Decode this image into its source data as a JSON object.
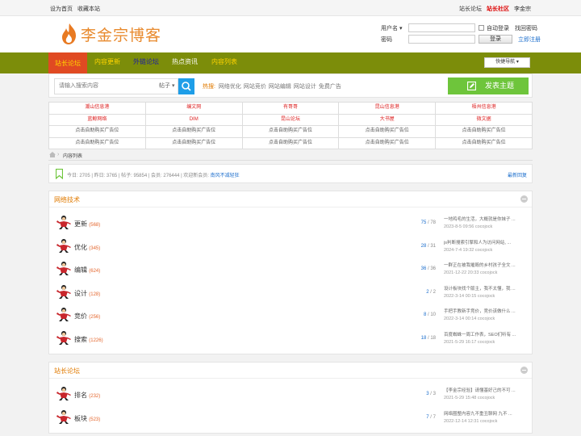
{
  "topbar": {
    "left": [
      "设为首页",
      "收藏本站"
    ],
    "right": [
      "站长论坛",
      "站长社区",
      "李金宗"
    ]
  },
  "logo": {
    "text": "李金宗博客"
  },
  "login": {
    "username_label": "用户名",
    "password_label": "密码",
    "auto_login": "自动登录",
    "forgot": "找回密码",
    "login_btn": "登录",
    "register": "立即注册"
  },
  "nav": {
    "items": [
      "站长论坛",
      "内容更新",
      "外链论坛",
      "热点资讯",
      "内容列表"
    ],
    "colors": [
      "#ffd400",
      "#ffd400",
      "#1a1aa6",
      "#ffffff",
      "#ffd400"
    ],
    "quick": "快捷导航"
  },
  "search": {
    "placeholder": "请输入搜索内容",
    "type": "帖子",
    "hot_label": "热搜:",
    "hot": [
      "网络优化",
      "网站竞价",
      "网站编辑",
      "网站设计",
      "免费广告"
    ],
    "post_btn": "发表主题"
  },
  "ads": {
    "rows": [
      [
        {
          "t": "潮山信息港",
          "c": "red"
        },
        {
          "t": "编文网",
          "c": "red"
        },
        {
          "t": "有哥哥",
          "c": "red"
        },
        {
          "t": "昆山信息港",
          "c": "red"
        },
        {
          "t": "梧州信息港",
          "c": "red"
        }
      ],
      [
        {
          "t": "蓝鲸网络",
          "c": "red"
        },
        {
          "t": "DIM",
          "c": "red"
        },
        {
          "t": "昆山论坛",
          "c": "red"
        },
        {
          "t": "大书屋",
          "c": "red"
        },
        {
          "t": "微文据",
          "c": "red"
        }
      ],
      [
        {
          "t": "点击自助购买广告位",
          "c": "gray"
        },
        {
          "t": "点击自助购买广告位",
          "c": "gray"
        },
        {
          "t": "点击自助购买广告位",
          "c": "gray"
        },
        {
          "t": "点击自助购买广告位",
          "c": "gray"
        },
        {
          "t": "点击自助购买广告位",
          "c": "gray"
        }
      ],
      [
        {
          "t": "点击自助购买广告位",
          "c": "gray"
        },
        {
          "t": "点击自助购买广告位",
          "c": "gray"
        },
        {
          "t": "点击自助购买广告位",
          "c": "gray"
        },
        {
          "t": "点击自助购买广告位",
          "c": "gray"
        },
        {
          "t": "点击自助购买广告位",
          "c": "gray"
        }
      ]
    ]
  },
  "breadcrumb": {
    "current": "内容列表"
  },
  "stats": {
    "text": "今日: 2705 | 昨日: 3765 | 帖子: 95854 | 会员: 276444 | 欢迎新会员:",
    "new_member": "南风不减轻狂",
    "latest": "最新回复"
  },
  "sections": [
    {
      "title": "网络技术",
      "forums": [
        {
          "name": "更新",
          "count": "(568)",
          "threads": "75",
          "posts": "78",
          "last_title": "一地鸡毛的生活，大概就是你妹子 ...",
          "last_date": "2023-8-5 09:56 cocojock"
        },
        {
          "name": "优化",
          "count": "(345)",
          "threads": "28",
          "posts": "31",
          "last_title": "js判断搜索引擎和人为访问网站, ...",
          "last_date": "2024-7-4 19:32 cocojock"
        },
        {
          "name": "编辑",
          "count": "(624)",
          "threads": "36",
          "posts": "36",
          "last_title": "一群正在被我摧毁的乡村孩子全文 ...",
          "last_date": "2021-12-22 20:33 cocojock"
        },
        {
          "name": "设计",
          "count": "(128)",
          "threads": "2",
          "posts": "2",
          "last_title": "设计板块找个版主，我不太懂，我 ...",
          "last_date": "2022-3-14 00:15 cocojock"
        },
        {
          "name": "竞价",
          "count": "(256)",
          "threads": "8",
          "posts": "10",
          "last_title": "手把手教新手竞价，竞价该做什么 ...",
          "last_date": "2022-3-14 00:14 cocojock"
        },
        {
          "name": "搜索",
          "count": "(1226)",
          "threads": "18",
          "posts": "18",
          "last_title": "百度蜘蛛一周工作表，SEO们听有 ...",
          "last_date": "2021-5-29 16:17 cocojock"
        }
      ]
    },
    {
      "title": "站长论坛",
      "forums": [
        {
          "name": "排名",
          "count": "(232)",
          "threads": "3",
          "posts": "3",
          "last_title": "【李金宗经验】请懂基好己的不可 ...",
          "last_date": "2021-5-29 15:48 cocojock"
        },
        {
          "name": "板块",
          "count": "(523)",
          "threads": "7",
          "posts": "7",
          "last_title": "网络圈整内容九不重丑聊网 九不 ...",
          "last_date": "2022-12-14 12:31 cocojock"
        }
      ]
    }
  ]
}
